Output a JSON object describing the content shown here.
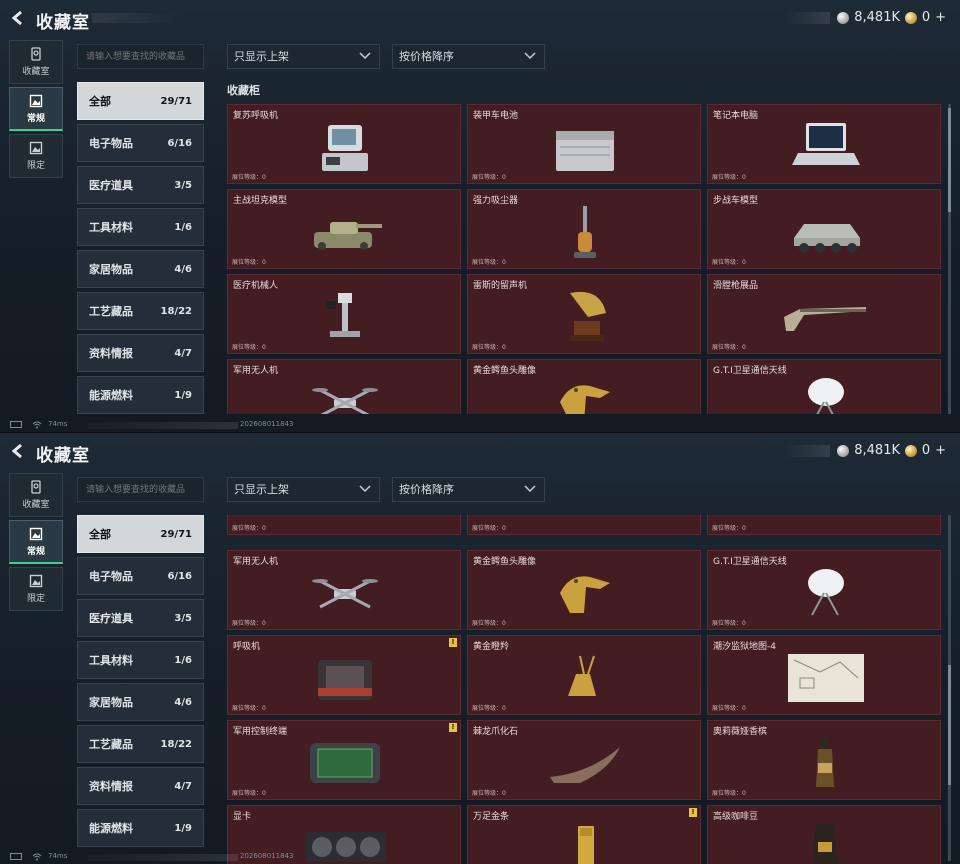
{
  "app": {
    "title": "收藏室",
    "currency_value": "8,481K",
    "bonds_value": "0",
    "bonds_plus": "+"
  },
  "nav_tabs": [
    {
      "label": "收藏室",
      "icon": "badge-icon"
    },
    {
      "label": "常规",
      "icon": "image-frame-icon",
      "active": true
    },
    {
      "label": "限定",
      "icon": "image-frame-icon"
    }
  ],
  "search": {
    "placeholder": "请输入想要查找的收藏品"
  },
  "filters": {
    "shelf_label": "只显示上架",
    "sort_label": "按价格降序"
  },
  "categories": [
    {
      "label": "全部",
      "count": "29/71"
    },
    {
      "label": "电子物品",
      "count": "6/16"
    },
    {
      "label": "医疗道具",
      "count": "3/5"
    },
    {
      "label": "工具材料",
      "count": "1/6"
    },
    {
      "label": "家居物品",
      "count": "4/6"
    },
    {
      "label": "工艺藏品",
      "count": "18/22"
    },
    {
      "label": "资料情报",
      "count": "4/7"
    },
    {
      "label": "能源燃料",
      "count": "1/9"
    }
  ],
  "section_label": "收藏柜",
  "level_label": "展位等级：0",
  "items_top": [
    {
      "name": "复苏呼吸机",
      "art": "resuscitator-icon"
    },
    {
      "name": "装甲车电池",
      "art": "battery-icon"
    },
    {
      "name": "笔记本电脑",
      "art": "laptop-icon"
    },
    {
      "name": "主战坦克模型",
      "art": "tank-model-icon"
    },
    {
      "name": "强力吸尘器",
      "art": "vacuum-icon"
    },
    {
      "name": "步战车模型",
      "art": "apc-model-icon"
    },
    {
      "name": "医疗机械人",
      "art": "medical-robot-icon"
    },
    {
      "name": "雷斯的留声机",
      "art": "gramophone-icon"
    },
    {
      "name": "滑膛枪展品",
      "art": "musket-icon"
    },
    {
      "name": "军用无人机",
      "art": "drone-icon"
    },
    {
      "name": "黄金鳄鱼头雕像",
      "art": "gold-croc-statue-icon"
    },
    {
      "name": "G.T.I卫星通信天线",
      "art": "satellite-dish-icon"
    }
  ],
  "items_bottom": [
    {
      "name": "军用无人机",
      "art": "drone-icon"
    },
    {
      "name": "黄金鳄鱼头雕像",
      "art": "gold-croc-statue-icon"
    },
    {
      "name": "G.T.I卫星通信天线",
      "art": "satellite-dish-icon"
    },
    {
      "name": "呼吸机",
      "art": "ventilator-icon",
      "badge": "!"
    },
    {
      "name": "黄金瞪羚",
      "art": "gold-gazelle-icon"
    },
    {
      "name": "潮汐监狱地图-4",
      "art": "map-icon"
    },
    {
      "name": "军用控制终端",
      "art": "control-terminal-icon",
      "badge": "!"
    },
    {
      "name": "棘龙爪化石",
      "art": "claw-fossil-icon"
    },
    {
      "name": "奥莉薇娅香槟",
      "art": "champagne-icon"
    },
    {
      "name": "显卡",
      "art": "gpu-icon"
    },
    {
      "name": "万足金条",
      "art": "gold-bar-icon",
      "badge": "!"
    },
    {
      "name": "高级咖啡豆",
      "art": "coffee-bag-icon"
    }
  ],
  "footer": {
    "ping": "74ms",
    "uid": "202608011843"
  }
}
